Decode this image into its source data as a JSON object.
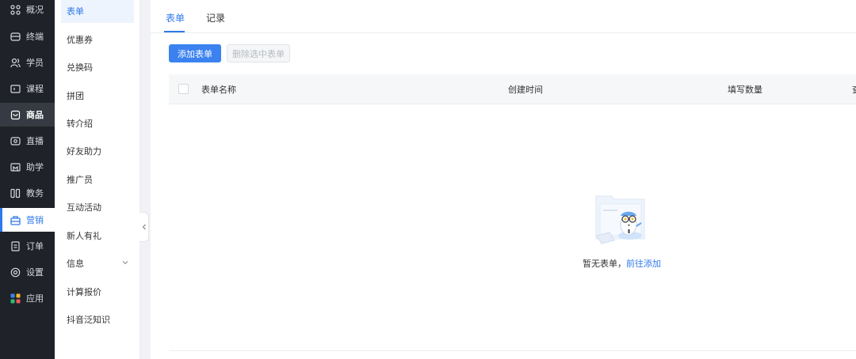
{
  "nav": {
    "items": [
      {
        "label": "概况",
        "icon": "grid-icon"
      },
      {
        "label": "终端",
        "icon": "terminal-icon"
      },
      {
        "label": "学员",
        "icon": "users-icon"
      },
      {
        "label": "课程",
        "icon": "course-icon"
      },
      {
        "label": "商品",
        "icon": "goods-icon"
      },
      {
        "label": "直播",
        "icon": "live-icon"
      },
      {
        "label": "助学",
        "icon": "study-icon"
      },
      {
        "label": "教务",
        "icon": "teaching-icon"
      },
      {
        "label": "营销",
        "icon": "marketing-icon"
      },
      {
        "label": "订单",
        "icon": "order-icon"
      },
      {
        "label": "设置",
        "icon": "settings-icon"
      },
      {
        "label": "应用",
        "icon": "apps-icon"
      }
    ]
  },
  "submenu": {
    "items": [
      {
        "label": "表单"
      },
      {
        "label": "优惠券"
      },
      {
        "label": "兑换码"
      },
      {
        "label": "拼团"
      },
      {
        "label": "转介绍"
      },
      {
        "label": "好友助力"
      },
      {
        "label": "推广员"
      },
      {
        "label": "互动活动"
      },
      {
        "label": "新人有礼"
      },
      {
        "label": "信息"
      },
      {
        "label": "计算报价"
      },
      {
        "label": "抖音泛知识"
      }
    ]
  },
  "tabs": [
    {
      "label": "表单"
    },
    {
      "label": "记录"
    }
  ],
  "toolbar": {
    "add_label": "添加表单",
    "delete_label": "删除选中表单"
  },
  "table": {
    "columns": [
      "表单名称",
      "创建时间",
      "填写数量",
      "查"
    ]
  },
  "empty": {
    "text": "暂无表单，",
    "link": "前往添加"
  },
  "colors": {
    "accent": "#2f79e9",
    "sidebar_bg": "#1f2329"
  }
}
